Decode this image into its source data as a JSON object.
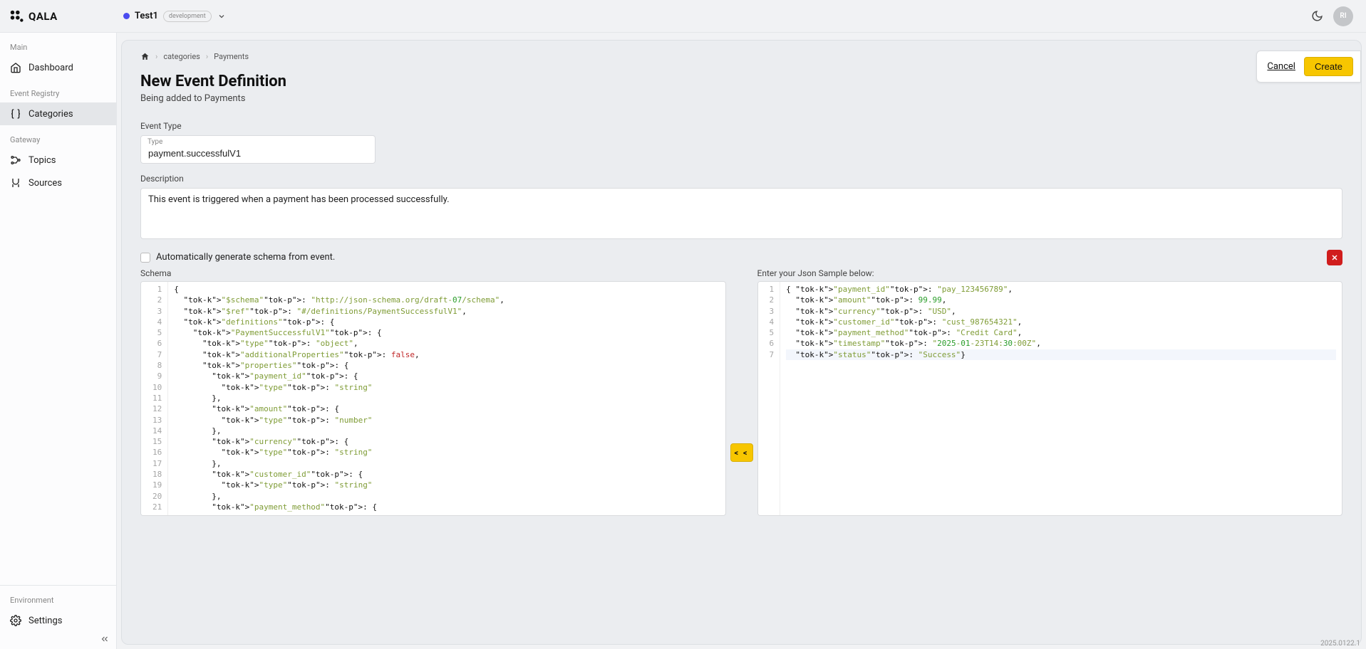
{
  "brand": "QALA",
  "project": {
    "name": "Test1",
    "env": "development"
  },
  "avatar": "RI",
  "sidebar": {
    "sections": [
      {
        "label": "Main",
        "items": [
          {
            "icon": "home",
            "label": "Dashboard",
            "active": false
          }
        ]
      },
      {
        "label": "Event Registry",
        "items": [
          {
            "icon": "braces",
            "label": "Categories",
            "active": true
          }
        ]
      },
      {
        "label": "Gateway",
        "items": [
          {
            "icon": "topics",
            "label": "Topics",
            "active": false
          },
          {
            "icon": "sources",
            "label": "Sources",
            "active": false
          }
        ]
      }
    ],
    "bottom": {
      "label": "Environment",
      "items": [
        {
          "icon": "gear",
          "label": "Settings"
        }
      ]
    }
  },
  "breadcrumb": [
    "categories",
    "Payments"
  ],
  "page": {
    "title": "New Event Definition",
    "subtitle": "Being added to Payments"
  },
  "actions": {
    "cancel": "Cancel",
    "create": "Create"
  },
  "form": {
    "eventTypeLabel": "Event Type",
    "typeFloat": "Type",
    "typeValue": "payment.successfulV1",
    "descriptionLabel": "Description",
    "descriptionValue": "This event is triggered when a payment has been processed successfully.",
    "autogen": "Automatically generate schema from event.",
    "schemaLabel": "Schema",
    "sampleLabel": "Enter your Json Sample below:",
    "transferBtn": "< <"
  },
  "schemaLines": [
    "{",
    "  \"$schema\": \"http://json-schema.org/draft-07/schema\",",
    "  \"$ref\": \"#/definitions/PaymentSuccessfulV1\",",
    "  \"definitions\": {",
    "    \"PaymentSuccessfulV1\": {",
    "      \"type\": \"object\",",
    "      \"additionalProperties\": false,",
    "      \"properties\": {",
    "        \"payment_id\": {",
    "          \"type\": \"string\"",
    "        },",
    "        \"amount\": {",
    "          \"type\": \"number\"",
    "        },",
    "        \"currency\": {",
    "          \"type\": \"string\"",
    "        },",
    "        \"customer_id\": {",
    "          \"type\": \"string\"",
    "        },",
    "        \"payment_method\": {"
  ],
  "sampleLines": [
    "{ \"payment_id\": \"pay_123456789\",",
    "  \"amount\": 99.99,",
    "  \"currency\": \"USD\",",
    "  \"customer_id\": \"cust_987654321\",",
    "  \"payment_method\": \"Credit Card\",",
    "  \"timestamp\": \"2025-01-23T14:30:00Z\",",
    "  \"status\": \"Success\"}"
  ],
  "version": "2025.0122.1"
}
